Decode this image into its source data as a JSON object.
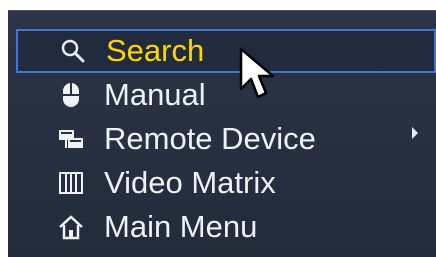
{
  "menu": {
    "items": [
      {
        "label": "Search",
        "icon": "search-icon",
        "selected": true
      },
      {
        "label": "Manual",
        "icon": "mouse-icon",
        "has_submenu": true
      },
      {
        "label": "Remote Device",
        "icon": "remote-device-icon"
      },
      {
        "label": "Video Matrix",
        "icon": "video-matrix-icon"
      },
      {
        "label": "Main Menu",
        "icon": "home-icon"
      }
    ],
    "colors": {
      "background": "#262f3f",
      "text": "#eef1f6",
      "selected_text": "#ffd400",
      "selection_border": "#3f74d8"
    }
  }
}
